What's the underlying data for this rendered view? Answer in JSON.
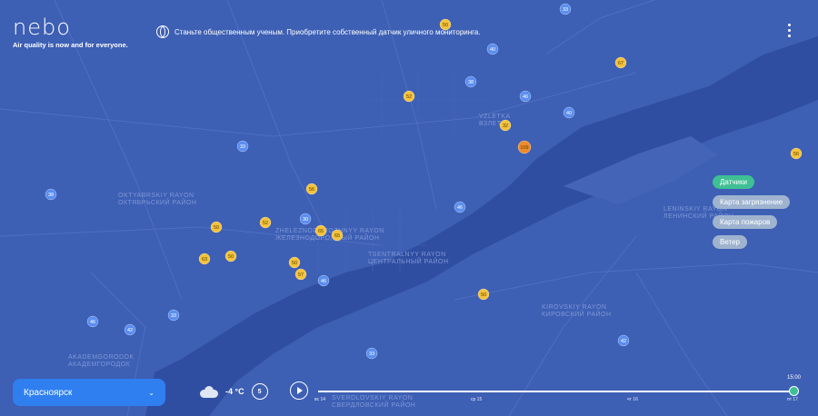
{
  "app": {
    "logo": "nebo",
    "tagline": "Air quality is now and for everyone.",
    "promo": "Станьте общественным ученым. Приобретите собственный датчик уличного мониторинга."
  },
  "layers": [
    {
      "label": "Датчики",
      "active": true
    },
    {
      "label": "Карта загрязнение",
      "active": false
    },
    {
      "label": "Карта пожаров",
      "active": false
    },
    {
      "label": "Ветер",
      "active": false
    }
  ],
  "city_select": {
    "value": "Красноярск"
  },
  "weather": {
    "temperature": "-4 °C",
    "wind_speed": "5"
  },
  "timeline": {
    "current_time": "15:00",
    "labels": [
      "вс 14",
      "ср 15",
      "чт 16",
      "пт 17"
    ]
  },
  "map_labels": [
    "OKTYABRSKIY RAYON",
    "ОКТЯБРЬСКИЙ РАЙОН",
    "ZHELEZNODOROZHNYY RAYON",
    "ЖЕЛЕЗНОДОРОЖНЫЙ РАЙОН",
    "TSENTRALNYY RAYON",
    "ЦЕНТРАЛЬНЫЙ РАЙОН",
    "KIROVSKIY RAYON",
    "КИРОВСКИЙ РАЙОН",
    "SVERDLOVSKIY RAYON",
    "СВЕРДЛОВСКИЙ РАЙОН",
    "AKADEMGORODOK",
    "АКАДЕМГОРОДОК",
    "LENINSKIY RAYON",
    "ЛЕНИНСКИЙ РАЙОН",
    "VZLETKA",
    "ВЗЛЕТКА"
  ],
  "sensors": [
    {
      "value": "50",
      "level": "moderate"
    },
    {
      "value": "33",
      "level": "good"
    },
    {
      "value": "40",
      "level": "good"
    },
    {
      "value": "67",
      "level": "moderate"
    },
    {
      "value": "52",
      "level": "moderate"
    },
    {
      "value": "38",
      "level": "good"
    },
    {
      "value": "46",
      "level": "good"
    },
    {
      "value": "40",
      "level": "good"
    },
    {
      "value": "32",
      "level": "moderate"
    },
    {
      "value": "109",
      "level": "unhealthy"
    },
    {
      "value": "33",
      "level": "good"
    },
    {
      "value": "56",
      "level": "moderate"
    },
    {
      "value": "38",
      "level": "good"
    },
    {
      "value": "56",
      "level": "moderate"
    },
    {
      "value": "30",
      "level": "good"
    },
    {
      "value": "52",
      "level": "moderate"
    },
    {
      "value": "50",
      "level": "moderate"
    },
    {
      "value": "65",
      "level": "moderate"
    },
    {
      "value": "65",
      "level": "moderate"
    },
    {
      "value": "46",
      "level": "good"
    },
    {
      "value": "63",
      "level": "moderate"
    },
    {
      "value": "50",
      "level": "moderate"
    },
    {
      "value": "50",
      "level": "moderate"
    },
    {
      "value": "57",
      "level": "moderate"
    },
    {
      "value": "46",
      "level": "good"
    },
    {
      "value": "50",
      "level": "moderate"
    },
    {
      "value": "46",
      "level": "good"
    },
    {
      "value": "42",
      "level": "good"
    },
    {
      "value": "33",
      "level": "good"
    },
    {
      "value": "33",
      "level": "good"
    },
    {
      "value": "42",
      "level": "good"
    }
  ],
  "colors": {
    "good": "#5b8ef0",
    "moderate": "#f5c23a",
    "unhealthy": "#f08a2a",
    "active_layer": "#3fbf94"
  }
}
